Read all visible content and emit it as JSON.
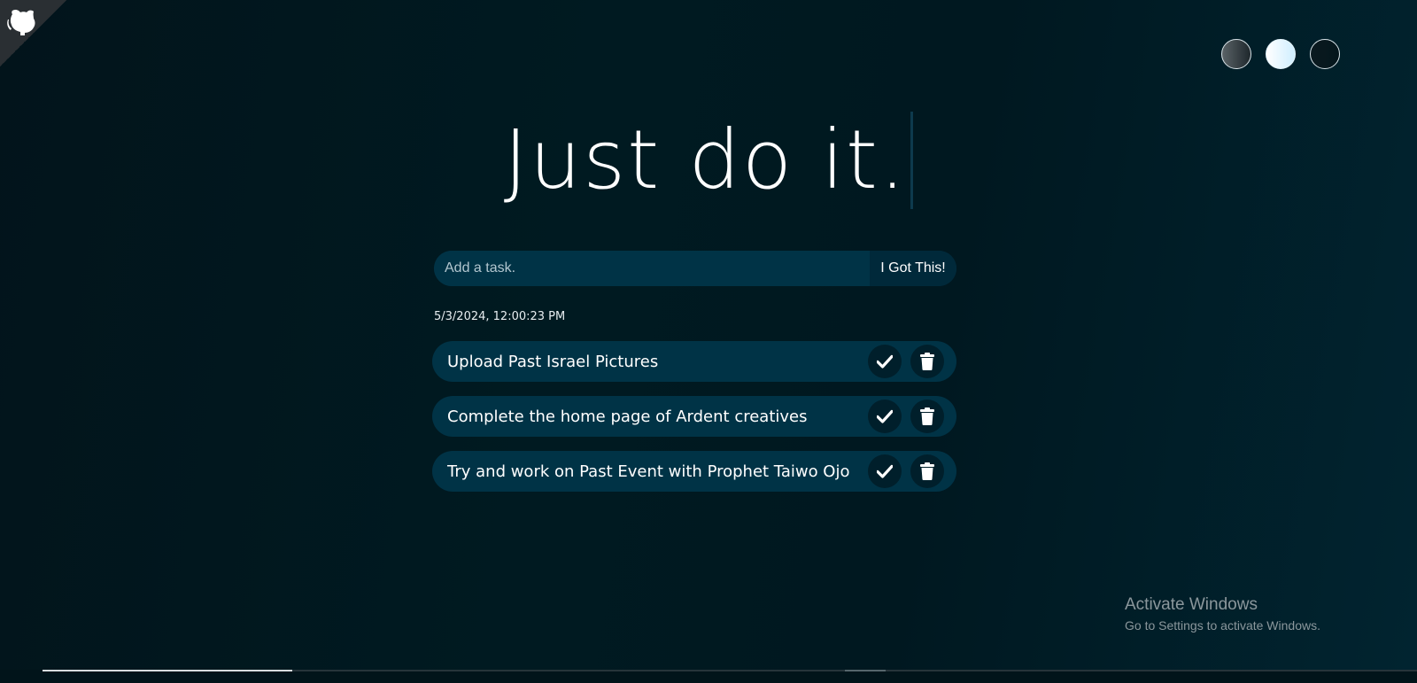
{
  "header": {
    "title": "Just do it.",
    "logo_icon": "cat-icon"
  },
  "themes": [
    {
      "name": "standard",
      "icon": "theme-standard-circle"
    },
    {
      "name": "light",
      "icon": "theme-light-circle"
    },
    {
      "name": "darker",
      "icon": "theme-darker-circle"
    }
  ],
  "form": {
    "placeholder": "Add a task.",
    "value": "",
    "submit_label": "I Got This!"
  },
  "datetime": "5/3/2024, 12:00:23 PM",
  "tasks": [
    {
      "text": "Upload Past Israel Pictures"
    },
    {
      "text": "Complete the home page of Ardent creatives"
    },
    {
      "text": "Try and work on Past Event with Prophet Taiwo Ojo"
    }
  ],
  "watermark": {
    "title": "Activate Windows",
    "subtitle": "Go to Settings to activate Windows."
  },
  "colors": {
    "accent": "#003346",
    "button_dark": "#00293a",
    "icon_bg": "#001f2b",
    "background": "#001a21"
  }
}
